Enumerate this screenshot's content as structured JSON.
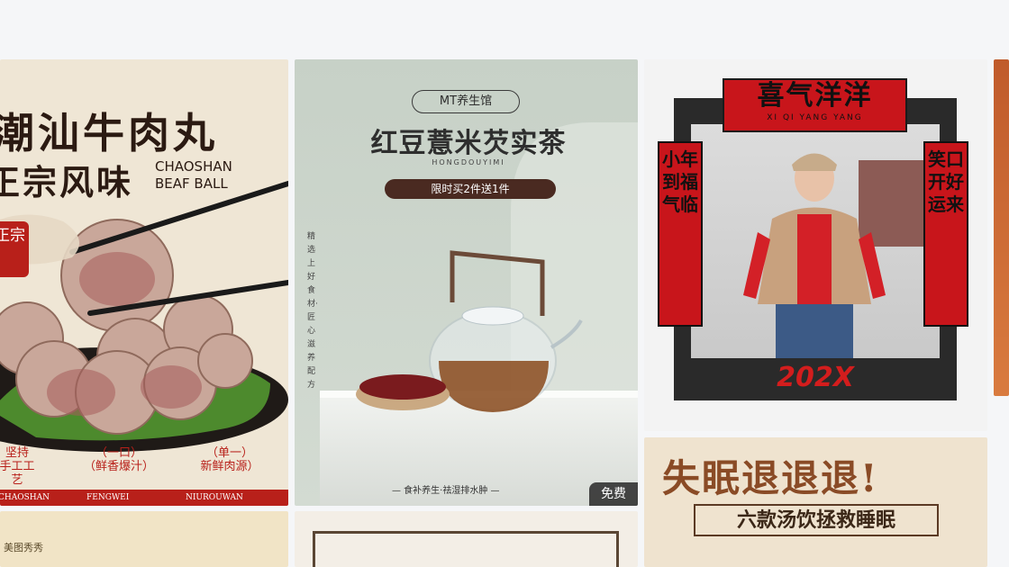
{
  "card_beefball": {
    "title_line1": "潮汕牛肉丸",
    "title_line2": "正宗风味",
    "en_line1": "CHAOSHAN",
    "en_line2": "BEAF BALL",
    "seal_text": "正宗",
    "features": [
      {
        "line1": "坚持",
        "line2": "手工工艺"
      },
      {
        "line1": "（一口）",
        "line2": "（鲜香爆汁）"
      },
      {
        "line1": "（单一）",
        "line2": "新鲜肉源）"
      }
    ],
    "band": [
      "CHAOSHAN",
      "FENGWEI",
      "NIUROUWAN"
    ]
  },
  "card_tea": {
    "brand": "MT养生馆",
    "title": "红豆薏米芡实茶",
    "pinyin": "HONGDOUYIMI",
    "promo": "限时买2件送1件",
    "side_text": "精选上好食材·匠心滋养配方",
    "footer": "— 食补养生·祛湿排水肿 —",
    "badge": "免费"
  },
  "card_newyear": {
    "banner_cn": "喜气洋洋",
    "banner_pinyin": "XI QI YANG YANG",
    "couplet_left": "小年到福气临",
    "couplet_right": "笑口开好运来",
    "year": "202X"
  },
  "card_sleep": {
    "title": "失眠退退退!",
    "subtitle": "六款汤饮拯救睡眠"
  },
  "card_peek": {
    "watermark": "美图秀秀"
  }
}
